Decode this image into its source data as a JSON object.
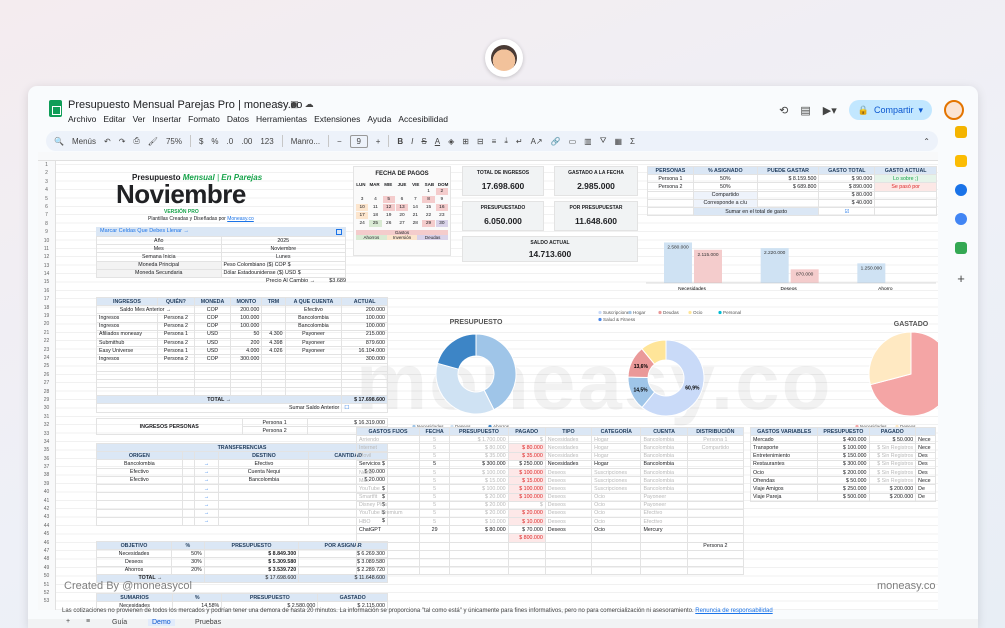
{
  "window": {
    "doc_title": "Presupuesto Mensual Parejas Pro | moneasy.co",
    "menu": [
      "Archivo",
      "Editar",
      "Ver",
      "Insertar",
      "Formato",
      "Datos",
      "Herramientas",
      "Extensiones",
      "Ayuda",
      "Accesibilidad"
    ],
    "share_label": "Compartir"
  },
  "toolbar": {
    "menus_label": "Menús",
    "zoom": "75%",
    "font": "Manro...",
    "font_size": "9",
    "num_fmt": "123"
  },
  "hero": {
    "line1a": "Presupuesto",
    "line1b": "Mensual",
    "line1c": "En Parejas",
    "month": "Noviembre",
    "version": "VERSIÓN PRO",
    "credit_prefix": "Plantillas Creadas y Diseñadas por",
    "credit_link": "Moneasy.co"
  },
  "config": {
    "mark_cells": "Marcar Celdas Que Debes Llenar →",
    "rows": [
      {
        "label": "Año",
        "value": "2025"
      },
      {
        "label": "Mes",
        "value": "Noviembre"
      },
      {
        "label": "Semana Inicia",
        "value": "Lunes"
      }
    ],
    "currency_rows": [
      {
        "label": "Moneda Principal",
        "value": "Peso Colombiano ($)",
        "code": "COP",
        "sym": "$"
      },
      {
        "label": "Moneda Secundaria",
        "value": "Dólar Estadounidense ($)",
        "code": "USD",
        "sym": "$"
      }
    ],
    "fx_label": "Precio Al Cambio →",
    "fx_value": "$3.689"
  },
  "calendar": {
    "title": "FECHA DE PAGOS",
    "days": [
      "LUN",
      "MAR",
      "MIE",
      "JUE",
      "VIE",
      "SAB",
      "DOM"
    ],
    "cells": [
      "",
      "",
      "",
      "",
      "",
      "1",
      "2",
      "3",
      "4",
      "5",
      "6",
      "7",
      "8",
      "9",
      "10",
      "11",
      "12",
      "13",
      "14",
      "15",
      "16",
      "17",
      "18",
      "19",
      "20",
      "21",
      "22",
      "23",
      "24",
      "25",
      "26",
      "27",
      "28",
      "29",
      "30"
    ],
    "legend": {
      "gastos": "Gastos",
      "ahorros": "Ahorros",
      "inversion": "Inversión",
      "deudas": "Deudas"
    }
  },
  "kpis": {
    "total_ingresos": {
      "label": "TOTAL DE INGRESOS",
      "value": "17.698.600"
    },
    "gastado_fecha": {
      "label": "GASTADO A LA FECHA",
      "value": "2.985.000"
    },
    "presupuestado": {
      "label": "PRESUPUESTADO",
      "value": "6.050.000"
    },
    "por_presupuestar": {
      "label": "POR PRESUPUESTAR",
      "value": "11.648.600"
    },
    "saldo_actual": {
      "label": "SALDO ACTUAL",
      "value": "14.713.600"
    }
  },
  "personas_tbl": {
    "headers": [
      "PERSONAS",
      "% ASIGNADO",
      "PUEDE GASTAR",
      "GASTO TOTAL",
      "GASTO ACTUAL"
    ],
    "rows": [
      {
        "name": "Persona 1",
        "pct": "50%",
        "can": "8.159.500",
        "total": "90.000",
        "status": "Lo sobre ;)"
      },
      {
        "name": "Persona 2",
        "pct": "50%",
        "can": "689.800",
        "total": "890.000",
        "status": "Se pasó por"
      }
    ],
    "compartido_label": "Compartido",
    "compartido_value": "80.000",
    "compone_label": "Corresponde a c/u",
    "compone_value": "40.000",
    "sumar_label": "Sumar en el total de gasto"
  },
  "bar_chart": {
    "categories": [
      "Necesidades",
      "Deseos",
      "Ahorro"
    ],
    "series": [
      {
        "name": "Presupuesto",
        "values": [
          2580000,
          2220000,
          1250000
        ]
      },
      {
        "name": "Gastado",
        "values": [
          2115000,
          870000,
          0
        ]
      }
    ]
  },
  "chart_data": [
    {
      "type": "pie",
      "title": "PRESUPUESTO",
      "categories": [
        "Necesidades",
        "Deseos",
        "Ahorros"
      ],
      "values": [
        42.6,
        36.7,
        20.7
      ],
      "colors": [
        "#9fc5e8",
        "#cfe2f3",
        "#3d85c6"
      ]
    },
    {
      "type": "pie",
      "title": "",
      "categories": [
        "Suscripciones",
        "Hogar",
        "Deudas",
        "Ocio",
        "Personal",
        "Salud & Fitness"
      ],
      "values": [
        60.9,
        14.5,
        13.6,
        11.0,
        0,
        0
      ],
      "colors": [
        "#c9daf8",
        "#9fc5e8",
        "#ea9999",
        "#ffe599",
        "#00bcd4",
        "#4a86e8"
      ],
      "labels": [
        "60,9%",
        "14,5%",
        "13,6%"
      ]
    },
    {
      "type": "pie",
      "title": "GASTADO",
      "categories": [
        "Necesidades",
        "Deseos"
      ],
      "values": [
        70.9,
        29.1
      ],
      "colors": [
        "#f4a5a5",
        "#ffe9c2"
      ]
    }
  ],
  "ingresos": {
    "headers": [
      "INGRESOS",
      "QUIÉN?",
      "MONEDA",
      "MONTO",
      "TRM",
      "A QUE CUENTA",
      "ACTUAL"
    ],
    "saldo_label": "Saldo Mes Anterior →",
    "rows": [
      {
        "a": "",
        "b": "Persona 2",
        "c": "COP",
        "d": "200.000",
        "e": "",
        "f": "Efectivo",
        "g": "200.000"
      },
      {
        "a": "Ingresos",
        "b": "Persona 2",
        "c": "COP",
        "d": "100.000",
        "e": "",
        "f": "Bancolombia",
        "g": "100.000"
      },
      {
        "a": "Ingresos",
        "b": "Persona 2",
        "c": "COP",
        "d": "100.000",
        "e": "",
        "f": "Bancolombia",
        "g": "100.000"
      },
      {
        "a": "Afiliados moneasy",
        "b": "Persona 1",
        "c": "USD",
        "d": "50",
        "e": "4.300",
        "f": "Payoneer",
        "g": "215.000"
      },
      {
        "a": "Submithub",
        "b": "Persona 2",
        "c": "USD",
        "d": "200",
        "e": "4.398",
        "f": "Payoneer",
        "g": "879.600"
      },
      {
        "a": "Easy Universe",
        "b": "Persona 1",
        "c": "USD",
        "d": "4.000",
        "e": "4.026",
        "f": "Payoneer",
        "g": "16.104.000"
      },
      {
        "a": "Ingresos",
        "b": "Persona 2",
        "c": "COP",
        "d": "300.000",
        "e": "",
        "f": "",
        "g": "300.000"
      }
    ],
    "total_label": "TOTAL →",
    "total_value": "17.698.600",
    "sumar_saldo": "Sumar Saldo Anterior"
  },
  "ingresos_personas": {
    "label": "INGRESOS PERSONAS",
    "rows": [
      {
        "p": "Persona 1",
        "v": "16.319.000"
      },
      {
        "p": "Persona 2",
        "v": "1.379.600"
      }
    ]
  },
  "transferencias": {
    "title": "TRANSFERENCIAS",
    "headers": [
      "ORIGEN",
      "DESTINO",
      "CANTIDAD"
    ],
    "rows": [
      {
        "o": "Bancolombia",
        "d": "Efectivo",
        "c": ""
      },
      {
        "o": "Efectivo",
        "d": "Cuenta Nequi",
        "c": "30.000"
      },
      {
        "o": "Efectivo",
        "d": "Bancolombia",
        "c": "20.000"
      }
    ]
  },
  "objetivo": {
    "headers": [
      "OBJETIVO",
      "%",
      "PRESUPUESTO",
      "POR ASIGNAR"
    ],
    "rows": [
      {
        "o": "Necesidades",
        "p": "50%",
        "b": "8.849.300",
        "a": "6.269.300"
      },
      {
        "o": "Deseos",
        "p": "30%",
        "b": "5.309.580",
        "a": "3.089.580"
      },
      {
        "o": "Ahorros",
        "p": "20%",
        "b": "3.539.720",
        "a": "2.289.720"
      }
    ],
    "total_label": "TOTAL →",
    "total_value": "17.698.600",
    "total_assign": "11.648.600"
  },
  "summary2": {
    "headers": [
      "SUMARIOS",
      "%",
      "PRESUPUESTO",
      "GASTADO"
    ],
    "rows": [
      {
        "o": "Necesidades",
        "p": "14,58%",
        "b": "2.580.000",
        "g": "2.115.000"
      }
    ]
  },
  "gastos_fijos": {
    "headers": [
      "GASTOS FIJOS",
      "FECHA",
      "PRESUPUESTO",
      "PAGADO",
      "TIPO",
      "CATEGORÍA",
      "CUENTA",
      "DISTRIBUCIÓN"
    ],
    "rows": [
      {
        "n": "Arriendo",
        "f": "5",
        "b": "1.700.000",
        "p": "",
        "t": "Necesidades",
        "c": "Hogar",
        "a": "Bancolombia",
        "d": "Persona 1",
        "faded": true
      },
      {
        "n": "Internet",
        "f": "5",
        "b": "80.000",
        "p": "80.000",
        "t": "Necesidades",
        "c": "Hogar",
        "a": "Bancolombia",
        "d": "Compartido",
        "faded": true
      },
      {
        "n": "Movil",
        "f": "5",
        "b": "35.000",
        "p": "35.000",
        "t": "Necesidades",
        "c": "Hogar",
        "a": "Bancolombia",
        "d": "",
        "faded": true
      },
      {
        "n": "Servicios",
        "f": "5",
        "b": "300.000",
        "p": "250.000",
        "t": "Necesidades",
        "c": "Hogar",
        "a": "Bancolombia",
        "d": "",
        "faded": false
      },
      {
        "n": "Netflix",
        "f": "5",
        "b": "100.000",
        "p": "100.000",
        "t": "Deseos",
        "c": "Suscripciones",
        "a": "Bancolombia",
        "d": "",
        "faded": true
      },
      {
        "n": "Max",
        "f": "5",
        "b": "15.000",
        "p": "15.000",
        "t": "Deseos",
        "c": "Suscripciones",
        "a": "Bancolombia",
        "d": "",
        "faded": true
      },
      {
        "n": "YouTube",
        "f": "5",
        "b": "100.000",
        "p": "100.000",
        "t": "Deseos",
        "c": "Suscripciones",
        "a": "Bancolombia",
        "d": "",
        "faded": true
      },
      {
        "n": "Smartfit",
        "f": "5",
        "b": "20.000",
        "p": "100.000",
        "t": "Deseos",
        "c": "Ocio",
        "a": "Payoneer",
        "d": "",
        "faded": true
      },
      {
        "n": "Disney Plus",
        "f": "5",
        "b": "20.000",
        "p": "",
        "t": "Deseos",
        "c": "Ocio",
        "a": "Payoneer",
        "d": "",
        "faded": true
      },
      {
        "n": "YouTube Premium",
        "f": "5",
        "b": "20.000",
        "p": "20.000",
        "t": "Deseos",
        "c": "Ocio",
        "a": "Efectivo",
        "d": "",
        "faded": true
      },
      {
        "n": "HBO",
        "f": "5",
        "b": "10.000",
        "p": "10.000",
        "t": "Deseos",
        "c": "Ocio",
        "a": "Efectivo",
        "d": "",
        "faded": true
      },
      {
        "n": "ChatGPT",
        "f": "29",
        "b": "80.000",
        "p": "70.000",
        "t": "Deseos",
        "c": "Ocio",
        "a": "Mercury",
        "d": "",
        "faded": false
      }
    ],
    "extra_paid": "800.000",
    "extra_person": "Persona 2"
  },
  "gastos_variables": {
    "headers": [
      "GASTOS VARIABLES",
      "PRESUPUESTO",
      "PAGADO"
    ],
    "rows": [
      {
        "n": "Mercado",
        "b": "400.000",
        "p": "50.000",
        "x": "Nece"
      },
      {
        "n": "Transporte",
        "b": "100.000",
        "p": "Sin Registros",
        "x": "Nece"
      },
      {
        "n": "Entretenimiento",
        "b": "150.000",
        "p": "Sin Registros",
        "x": "Des"
      },
      {
        "n": "Restaurantes",
        "b": "300.000",
        "p": "Sin Registros",
        "x": "Des"
      },
      {
        "n": "Ocio",
        "b": "200.000",
        "p": "Sin Registros",
        "x": "Des"
      },
      {
        "n": "Ofrendas",
        "b": "50.000",
        "p": "Sin Registros",
        "x": "Nece"
      },
      {
        "n": "Viaje Amigos",
        "b": "250.000",
        "p": "200.000",
        "x": "De"
      },
      {
        "n": "Viaje Pareja",
        "b": "500.000",
        "p": "200.000",
        "x": "De"
      }
    ]
  },
  "branding": {
    "created": "Created By @moneasycol",
    "brand_right": "moneasy.co",
    "watermark": "moneasy.co"
  },
  "disclaimer": {
    "text": "Las cotizaciones no provienen de todos los mercados y podrían tener una demora de hasta 20 minutos. La información se proporciona \"tal como está\" y únicamente para fines informativos, pero no para comercialización ni asesoramiento.",
    "link": "Renuncia de responsabilidad"
  },
  "tabs": [
    "Guía",
    "Demo",
    "Pruebas"
  ],
  "colors": {
    "accent": "#1a73e8",
    "green": "#16a34a",
    "share_bg": "#c2e7ff"
  }
}
